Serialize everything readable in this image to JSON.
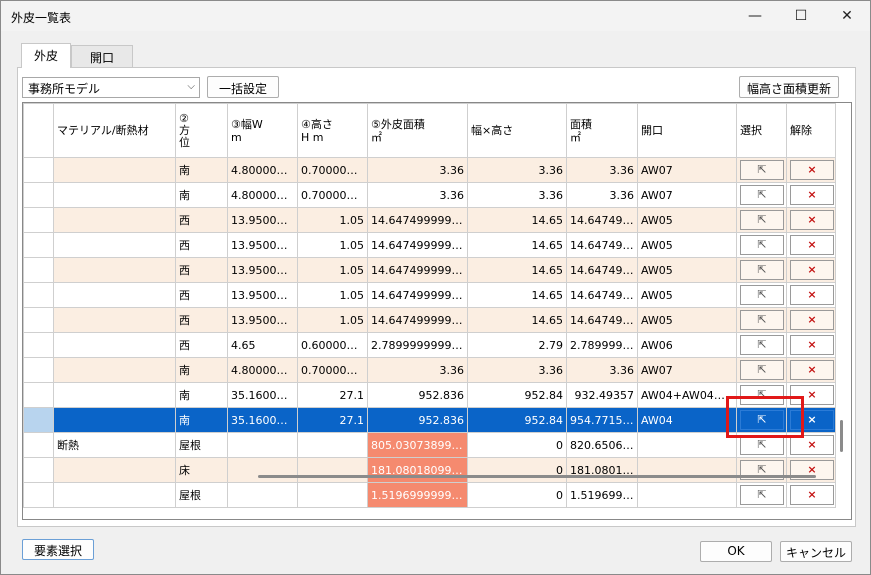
{
  "window": {
    "title": "外皮一覧表",
    "minimize_glyph": "—",
    "maximize_glyph": "☐",
    "close_glyph": "✕"
  },
  "tabs": [
    {
      "label": "外皮"
    },
    {
      "label": "開口"
    }
  ],
  "toolbar": {
    "model_select_value": "事務所モデル",
    "bulk_set_label": "一括設定",
    "update_label": "幅高さ面積更新"
  },
  "table": {
    "headers": {
      "material": "マテリアル/断熱材",
      "orientation": "②\n方\n位",
      "width": "③幅W\nm",
      "height": "④高さ\nH m",
      "area": "⑤外皮面積\n㎡",
      "wxh": "幅×高さ",
      "area2": "面積\n㎡",
      "opening": "開口",
      "select": "選択",
      "release": "解除"
    },
    "rows": [
      {
        "material": "",
        "orientation": "南",
        "width": "4.8000000...",
        "height": "0.7000000...",
        "area": "3.36",
        "wxh": "3.36",
        "area2": "3.36",
        "opening": "AW07",
        "select": "select-button",
        "release": "×"
      },
      {
        "material": "",
        "orientation": "南",
        "width": "4.8000000...",
        "height": "0.7000000...",
        "area": "3.36",
        "wxh": "3.36",
        "area2": "3.36",
        "opening": "AW07",
        "select": "select-button",
        "release": "×"
      },
      {
        "material": "",
        "orientation": "西",
        "width": "13.950000...",
        "height": "1.05",
        "area": "14.64749999999...",
        "wxh": "14.65",
        "area2": "14.647499...",
        "opening": "AW05",
        "select": "select-button",
        "release": "×"
      },
      {
        "material": "",
        "orientation": "西",
        "width": "13.950000...",
        "height": "1.05",
        "area": "14.64749999999...",
        "wxh": "14.65",
        "area2": "14.647499...",
        "opening": "AW05",
        "select": "select-button",
        "release": "×"
      },
      {
        "material": "",
        "orientation": "西",
        "width": "13.950000...",
        "height": "1.05",
        "area": "14.64749999999...",
        "wxh": "14.65",
        "area2": "14.647499...",
        "opening": "AW05",
        "select": "select-button",
        "release": "×"
      },
      {
        "material": "",
        "orientation": "西",
        "width": "13.950000...",
        "height": "1.05",
        "area": "14.64749999999...",
        "wxh": "14.65",
        "area2": "14.647499...",
        "opening": "AW05",
        "select": "select-button",
        "release": "×"
      },
      {
        "material": "",
        "orientation": "西",
        "width": "13.950000...",
        "height": "1.05",
        "area": "14.64749999999...",
        "wxh": "14.65",
        "area2": "14.647499...",
        "opening": "AW05",
        "select": "select-button",
        "release": "×"
      },
      {
        "material": "",
        "orientation": "西",
        "width": "4.65",
        "height": "0.6000000...",
        "area": "2.789999999999...",
        "wxh": "2.79",
        "area2": "2.7899999...",
        "opening": "AW06",
        "select": "select-button",
        "release": "×"
      },
      {
        "material": "",
        "orientation": "南",
        "width": "4.8000000...",
        "height": "0.7000000...",
        "area": "3.36",
        "wxh": "3.36",
        "area2": "3.36",
        "opening": "AW07",
        "select": "select-button",
        "release": "×"
      },
      {
        "material": "",
        "orientation": "南",
        "width": "35.160000...",
        "height": "27.1",
        "area": "952.836",
        "wxh": "952.84",
        "area2": "932.49357",
        "opening": "AW04+AW04+...",
        "select": "select-button",
        "release": "×"
      },
      {
        "material": "",
        "orientation": "南",
        "width": "35.160000...",
        "height": "27.1",
        "area": "952.836",
        "wxh": "952.84",
        "area2": "954.771574",
        "opening": "AW04",
        "select": "select-button",
        "release": "×"
      },
      {
        "material": "断熱",
        "orientation": "屋根",
        "width": "",
        "height": "",
        "area": "805.0307389999...",
        "wxh": "0",
        "area2": "820.65060...",
        "opening": "",
        "select": "select-button",
        "release": "×"
      },
      {
        "material": "",
        "orientation": "床",
        "width": "",
        "height": "",
        "area": "181.0801809999...",
        "wxh": "0",
        "area2": "181.08018...",
        "opening": "",
        "select": "select-button",
        "release": "×"
      },
      {
        "material": "",
        "orientation": "屋根",
        "width": "",
        "height": "",
        "area": "1.519699999999...",
        "wxh": "0",
        "area2": "1.5196999...",
        "opening": "",
        "select": "select-button",
        "release": "×"
      }
    ]
  },
  "footer": {
    "element_select_label": "要素選択",
    "ok_label": "OK",
    "cancel_label": "キャンセル"
  },
  "colors": {
    "selected_row": "#0a64c8",
    "alt_row": "#fbeee2",
    "warn_cell": "#f58a6f",
    "highlight_box": "#e11818"
  }
}
